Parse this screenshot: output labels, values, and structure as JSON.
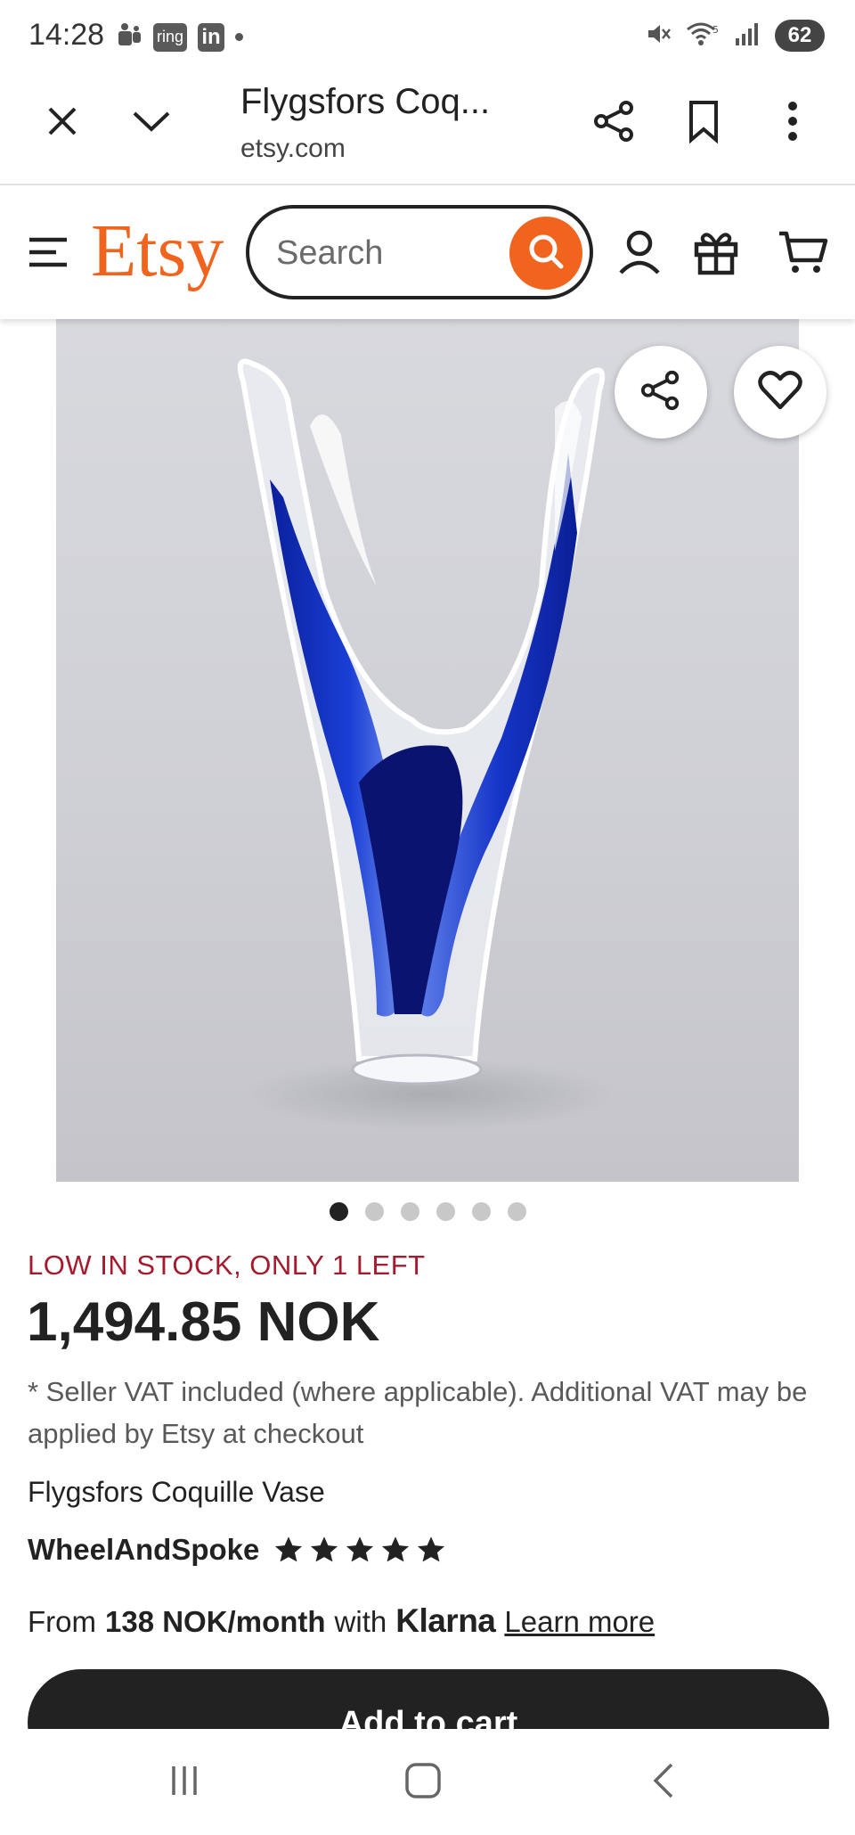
{
  "status_bar": {
    "time": "14:28",
    "app_icons": [
      "teams-icon",
      "ring-icon",
      "linkedin-icon"
    ],
    "ring_label": "ring",
    "linkedin_label": "in",
    "battery": "62"
  },
  "browser": {
    "page_title": "Flygsfors Coq...",
    "domain": "etsy.com"
  },
  "header": {
    "logo": "Etsy",
    "search_placeholder": "Search",
    "brand_color": "#f1641e"
  },
  "gallery": {
    "dot_count": 6,
    "active_dot": 0
  },
  "product": {
    "stock_notice": "LOW IN STOCK, ONLY 1 LEFT",
    "price": "1,494.85 NOK",
    "vat_note": "* Seller VAT included (where applicable). Additional VAT may be applied by Etsy at checkout",
    "title": "Flygsfors Coquille Vase",
    "shop_name": "WheelAndSpoke",
    "rating_stars": 5
  },
  "financing": {
    "prefix": "From",
    "amount": "138 NOK/month",
    "middle": "with",
    "provider": "Klarna",
    "link": "Learn more"
  },
  "cta": {
    "label": "Add to cart"
  }
}
